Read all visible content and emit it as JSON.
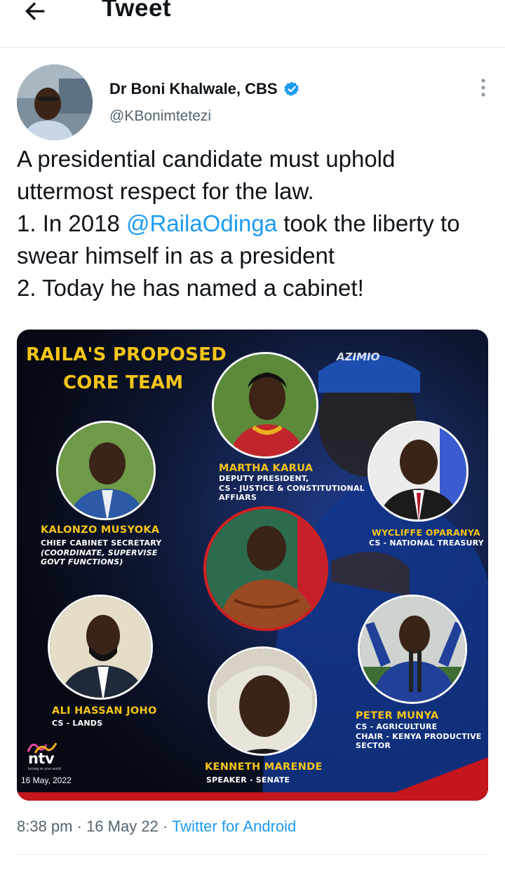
{
  "header": {
    "title": "Tweet",
    "back_icon": "arrow-left-icon"
  },
  "author": {
    "name": "Dr Boni Khalwale, CBS",
    "handle": "@KBonimtetezi",
    "verified": true,
    "verified_color": "#1d9bf0"
  },
  "tweet": {
    "line1": "A presidential candidate must uphold",
    "line2": "uttermost respect for the law.",
    "line3_prefix": "1. In 2018 ",
    "line3_mention": "@RailaOdinga",
    "line3_suffix": " took the liberty to",
    "line4": "swear himself in as a president",
    "line5": "2. Today he has named a cabinet!"
  },
  "media": {
    "heading_line1": "RAILA'S PROPOSED",
    "heading_line2": "CORE TEAM",
    "cap_logo": "AZIMIO",
    "brand": "ntv",
    "brand_tagline": "turning on your world",
    "date": "16 May, 2022",
    "members": [
      {
        "name": "MARTHA KARUA",
        "role": [
          "DEPUTY PRESIDENT,",
          "CS - JUSTICE & CONSTITUTIONAL",
          "AFFIARS"
        ]
      },
      {
        "name": "KALONZO MUSYOKA",
        "role": [
          "CHIEF CABINET SECRETARY",
          "(COORDINATE, SUPERVISE",
          "GOVT FUNCTIONS)"
        ]
      },
      {
        "name": "WYCLIFFE OPARANYA",
        "role": [
          "CS - NATIONAL TREASURY"
        ]
      },
      {
        "name": "ALI HASSAN JOHO",
        "role": [
          "CS - LANDS"
        ]
      },
      {
        "name": "PETER MUNYA",
        "role": [
          "CS - AGRICULTURE",
          "CHAIR - KENYA PRODUCTIVE",
          "SECTOR"
        ]
      },
      {
        "name": "KENNETH MARENDE",
        "role": [
          "SPEAKER - SENATE"
        ]
      }
    ],
    "accent": "#f5c518",
    "highlight": "#d32020"
  },
  "meta": {
    "time": "8:38 pm",
    "sep1": " · ",
    "date": "16 May 22",
    "sep2": " · ",
    "source": "Twitter for Android"
  }
}
